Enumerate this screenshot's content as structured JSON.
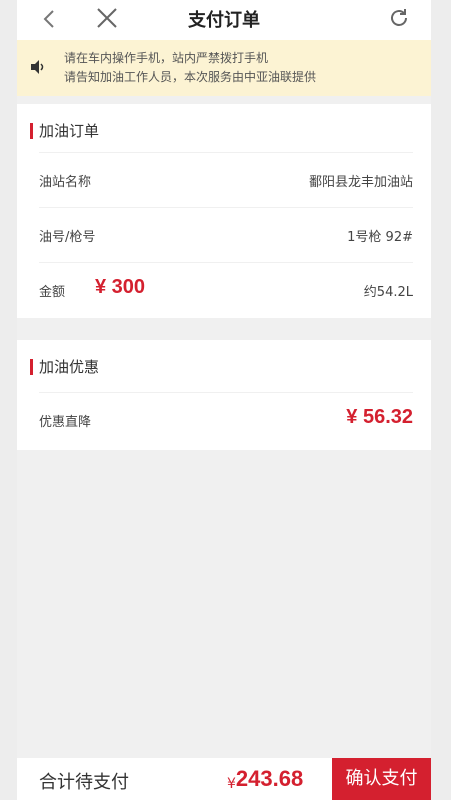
{
  "nav": {
    "title": "支付订单"
  },
  "notice": {
    "lines": [
      "请在车内操作手机，站内严禁拨打手机",
      "请告知加油工作人员，本次服务由中亚油联提供"
    ]
  },
  "order": {
    "section_title": "加油订单",
    "station_label": "油站名称",
    "station_value": "鄱阳县龙丰加油站",
    "fuel_label": "油号/枪号",
    "fuel_value": "1号枪 92#",
    "amount_label": "金额",
    "amount_value": "¥ 300",
    "volume_value": "约54.2L"
  },
  "discount": {
    "section_title": "加油优惠",
    "label": "优惠直降",
    "value": "¥ 56.32"
  },
  "bottom": {
    "total_label": "合计待支付",
    "currency": "¥",
    "total_amount": "243.68",
    "pay_button": "确认支付"
  },
  "colors": {
    "accent": "#d4202f",
    "notice_bg": "#fcf3d3",
    "page_bg": "#f0f0f0"
  }
}
